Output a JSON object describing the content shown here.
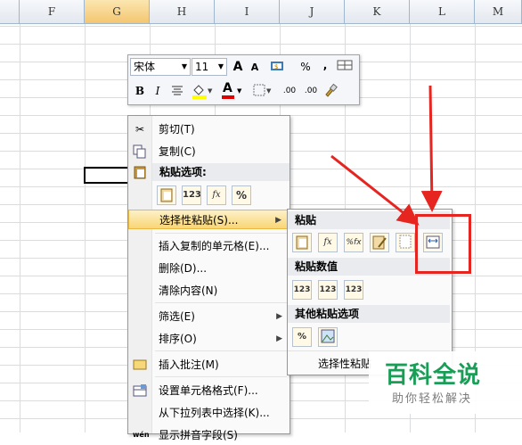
{
  "columns": [
    "F",
    "G",
    "H",
    "I",
    "J",
    "K",
    "L",
    "M"
  ],
  "selected_column": "G",
  "mini_toolbar": {
    "font_name": "宋体",
    "font_size": "11",
    "grow_font": "A",
    "shrink_font": "A",
    "percent": "%",
    "comma": ",",
    "bold": "B",
    "italic": "I",
    "font_color": "A",
    "inc_decimal": ".00",
    "dec_decimal": ".00",
    "highlight_color": "#ffff00",
    "text_color": "#e00000"
  },
  "context_menu": {
    "cut": "剪切(T)",
    "copy": "复制(C)",
    "paste_options": "粘贴选项:",
    "paste_buttons": [
      "",
      "123",
      "fx",
      "%"
    ],
    "paste_special": "选择性粘贴(S)...",
    "insert_copied": "插入复制的单元格(E)...",
    "delete": "删除(D)...",
    "clear": "清除内容(N)",
    "filter": "筛选(E)",
    "sort": "排序(O)",
    "insert_comment": "插入批注(M)",
    "format_cells": "设置单元格格式(F)...",
    "pick_list": "从下拉列表中选择(K)...",
    "phonetic": "显示拼音字段(S)"
  },
  "submenu": {
    "paste_header": "粘贴",
    "paste_buttons": [
      "",
      "fx",
      "%fx",
      "",
      "",
      ""
    ],
    "values_header": "粘贴数值",
    "values_buttons": [
      "123",
      "123",
      "123"
    ],
    "other_header": "其他粘贴选项",
    "other_buttons": [
      "%",
      ""
    ],
    "footer_item": "选择性粘贴"
  },
  "watermark": {
    "title": "百科全说",
    "subtitle": "助你轻松解决"
  },
  "colors": {
    "annotation_red": "#e62420",
    "watermark_green": "#1a9e57"
  }
}
